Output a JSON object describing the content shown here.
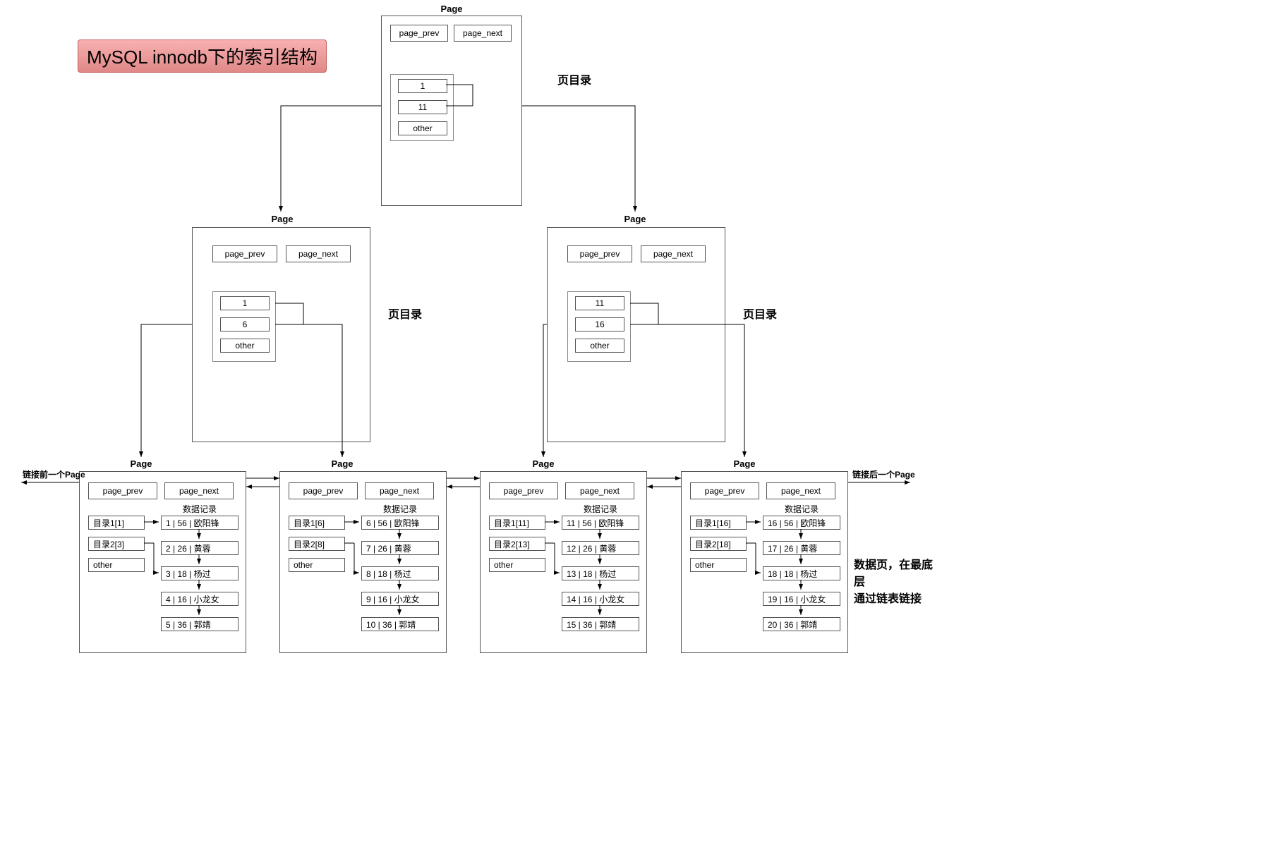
{
  "title": "MySQL innodb下的索引结构",
  "labels": {
    "page": "Page",
    "page_prev": "page_prev",
    "page_next": "page_next",
    "other": "other",
    "dir": "页目录",
    "data_record": "数据记录",
    "link_prev": "链接前一个Page",
    "link_next": "链接后一个Page",
    "note1": "数据页，在最底层",
    "note2": "通过链表链接"
  },
  "root": {
    "slots": [
      "1",
      "11",
      "other"
    ]
  },
  "mid": [
    {
      "slots": [
        "1",
        "6",
        "other"
      ]
    },
    {
      "slots": [
        "11",
        "16",
        "other"
      ]
    }
  ],
  "leaf": [
    {
      "dir": [
        "目录1[1]",
        "目录2[3]",
        "other"
      ],
      "rows": [
        "1 | 56 | 欧阳锋",
        "2 | 26 | 黄蓉",
        "3 | 18 | 杨过",
        "4 | 16 | 小龙女",
        "5 | 36 | 郭靖"
      ]
    },
    {
      "dir": [
        "目录1[6]",
        "目录2[8]",
        "other"
      ],
      "rows": [
        "6 | 56 | 欧阳锋",
        "7 | 26 | 黄蓉",
        "8 | 18 | 杨过",
        "9 | 16 | 小龙女",
        "10 | 36 | 郭靖"
      ]
    },
    {
      "dir": [
        "目录1[11]",
        "目录2[13]",
        "other"
      ],
      "rows": [
        "11 | 56 | 欧阳锋",
        "12 | 26 | 黄蓉",
        "13 | 18 | 杨过",
        "14 | 16 | 小龙女",
        "15 | 36 | 郭靖"
      ]
    },
    {
      "dir": [
        "目录1[16]",
        "目录2[18]",
        "other"
      ],
      "rows": [
        "16 | 56 | 欧阳锋",
        "17 | 26 | 黄蓉",
        "18 | 18 | 杨过",
        "19 | 16 | 小龙女",
        "20 | 36 | 郭靖"
      ]
    }
  ]
}
